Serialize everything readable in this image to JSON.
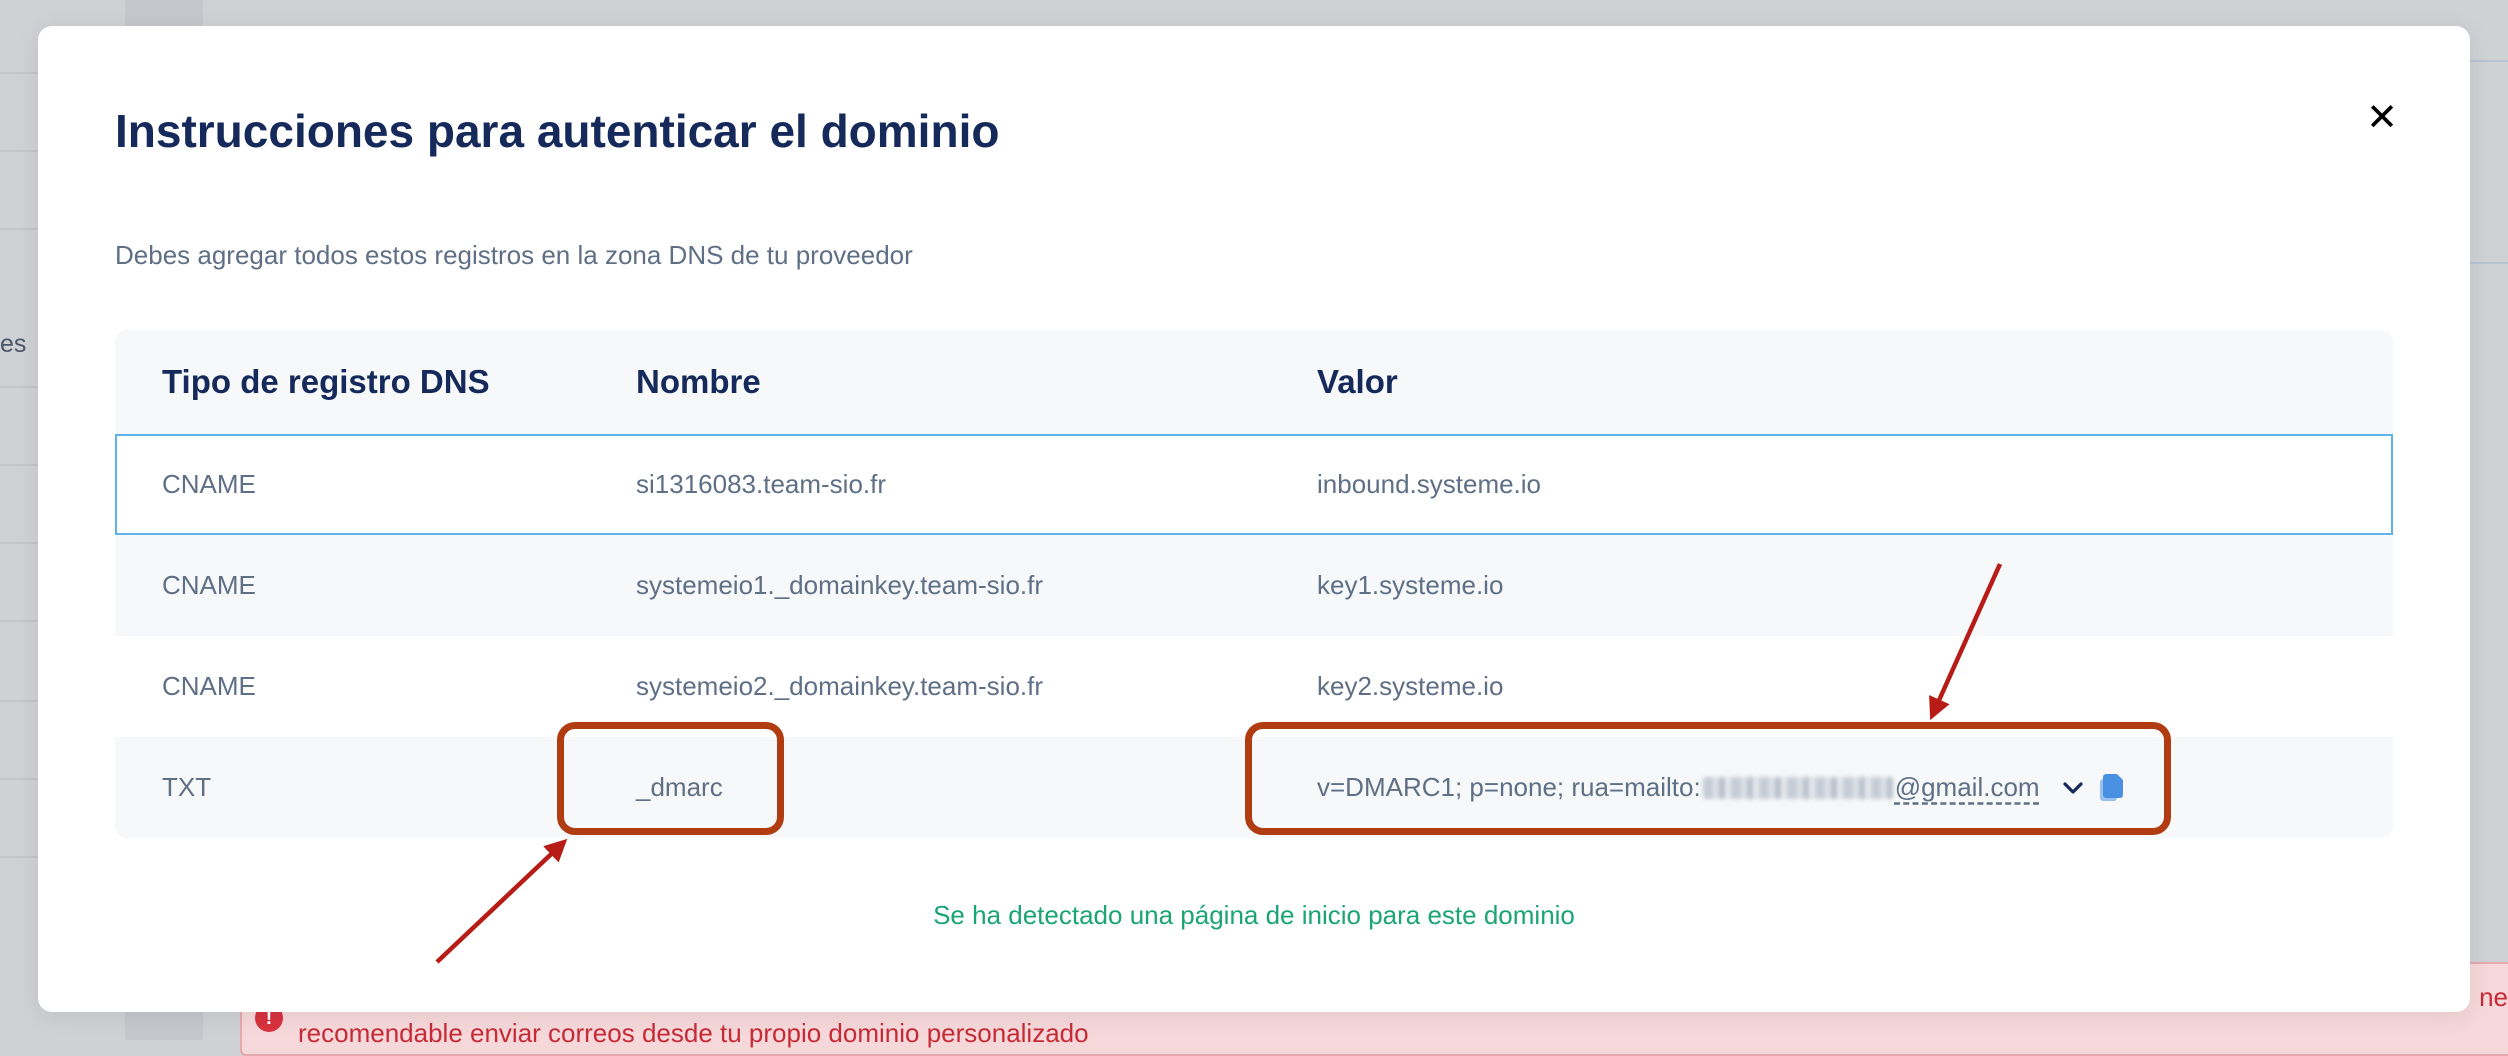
{
  "modal": {
    "title": "Instrucciones para autenticar el dominio",
    "close_icon": "close-icon",
    "subtitle": "Debes agregar todos estos registros en la zona DNS de tu proveedor",
    "status_message": "Se ha detectado una página de inicio para este dominio"
  },
  "table": {
    "headers": [
      "Tipo de registro DNS",
      "Nombre",
      "Valor"
    ],
    "rows": [
      {
        "type": "CNAME",
        "name": "si1316083.team-sio.fr",
        "value": "inbound.systeme.io"
      },
      {
        "type": "CNAME",
        "name": "systemeio1._domainkey.team-sio.fr",
        "value": "key1.systeme.io"
      },
      {
        "type": "CNAME",
        "name": "systemeio2._domainkey.team-sio.fr",
        "value": "key2.systeme.io"
      },
      {
        "type": "TXT",
        "name": "_dmarc",
        "value_prefix": "v=DMARC1; p=none; rua=mailto:",
        "value_email_domain": "@gmail.com",
        "value_icons": [
          "chevron-down-icon",
          "copy-icon"
        ]
      }
    ]
  },
  "background": {
    "left_fragment": "es",
    "alert_text": "recomendable enviar correos desde tu propio dominio personalizado",
    "alert_right_fragment": "ne",
    "alert_icon": "exclamation-icon"
  },
  "colors": {
    "title": "#15295a",
    "muted_text": "#5f6f86",
    "success_text": "#1aa572",
    "highlight_border": "#b23c12",
    "selected_row_border": "#5db3ea",
    "copy_icon": "#4a90e2"
  }
}
